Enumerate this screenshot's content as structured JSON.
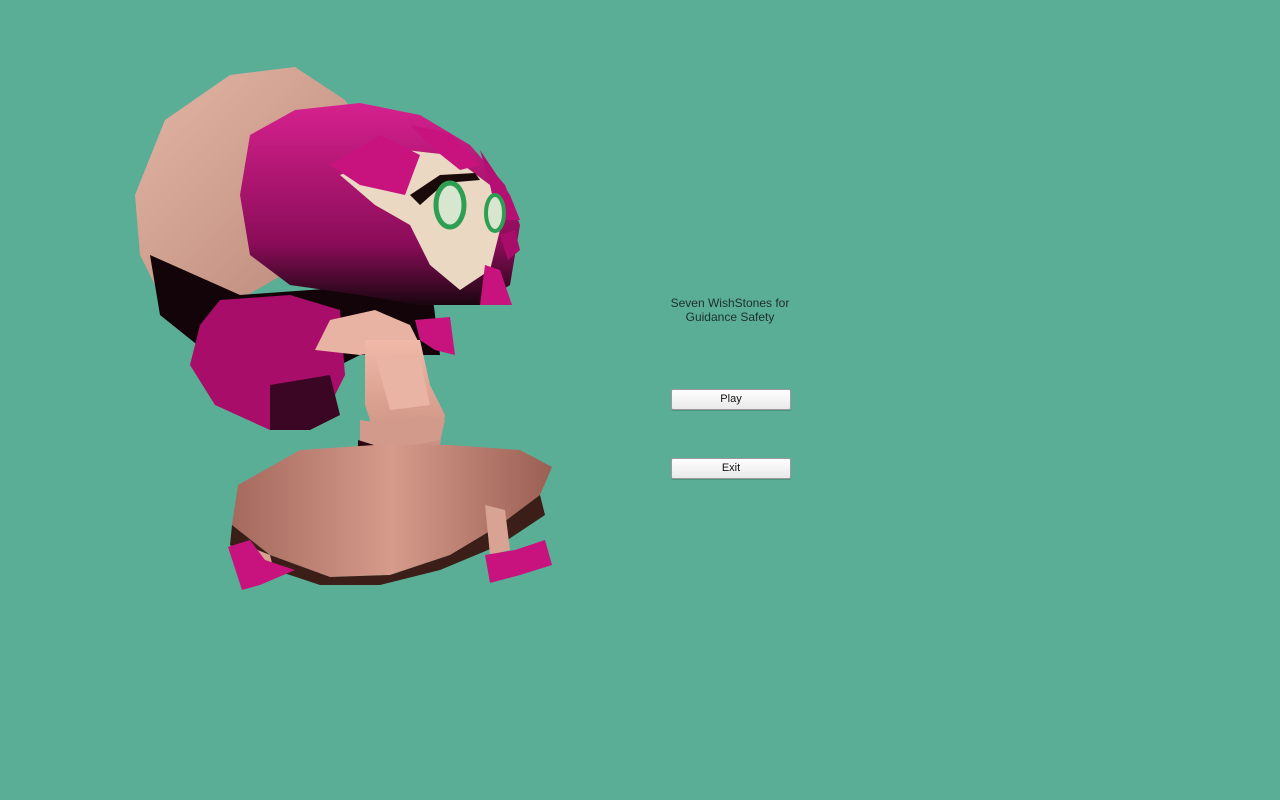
{
  "colors": {
    "background": "#5aae96",
    "hair": "#c8137f",
    "hat": "#e0b0a0",
    "dress": "#c9877a",
    "eyes": "#2e9f52"
  },
  "menu": {
    "title_line1": "Seven WishStones for",
    "title_line2": "Guidance Safety",
    "play_label": "Play",
    "exit_label": "Exit"
  },
  "character": {
    "icon": "girl-character-3d-model"
  }
}
